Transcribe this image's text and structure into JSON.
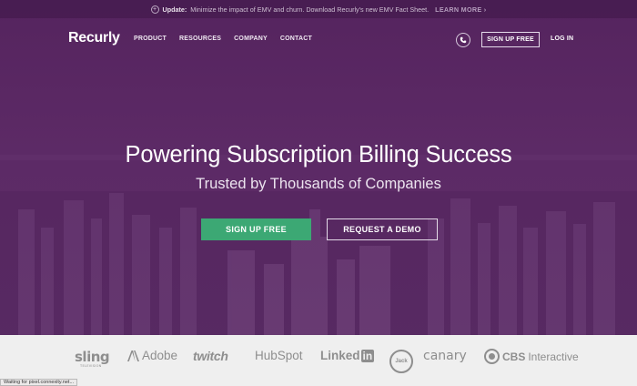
{
  "announcement": {
    "icon": "plus-circle-icon",
    "prefix": "Update:",
    "text": "Minimize the impact of EMV and churn. Download Recurly's new EMV Fact Sheet.",
    "link": "LEARN MORE",
    "chevron": "›"
  },
  "header": {
    "logo": "Recurly",
    "nav": [
      "PRODUCT",
      "RESOURCES",
      "COMPANY",
      "CONTACT"
    ],
    "phone_icon": "phone-icon",
    "signup_label": "SIGN UP FREE",
    "login_label": "LOG IN"
  },
  "hero": {
    "headline": "Powering Subscription Billing Success",
    "subheadline": "Trusted by Thousands of Companies",
    "primary_cta": "SIGN UP FREE",
    "secondary_cta": "REQUEST A DEMO"
  },
  "clients": {
    "sling": "sling",
    "sling_sub": "TELEVISION",
    "adobe": "Adobe",
    "twitch": "twitch",
    "hubspot": "HubSpot",
    "linkedin_text": "Linked",
    "linkedin_in": "in",
    "jack": "Jack",
    "canary": "canary",
    "cbs_bold": "CBS",
    "cbs_light": "Interactive"
  },
  "status_bar": "Waiting for pixel.connexity.net...",
  "colors": {
    "hero_overlay": "#5d2d66",
    "cta_green": "#3ca874",
    "logo_strip": "#efefef"
  }
}
